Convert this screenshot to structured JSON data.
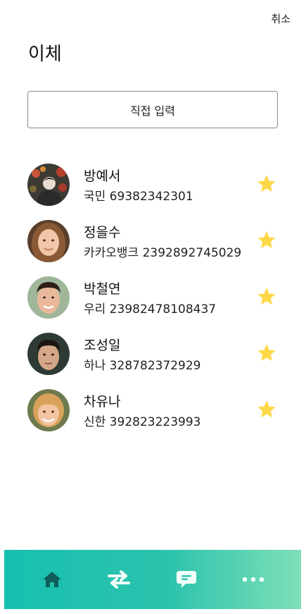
{
  "header": {
    "cancel_label": "취소",
    "title": "이체"
  },
  "direct_input_label": "직접 입력",
  "favorites": [
    {
      "name": "방예서",
      "account": "국민 69382342301",
      "starred": true
    },
    {
      "name": "정을수",
      "account": "카카오뱅크 2392892745029",
      "starred": true
    },
    {
      "name": "박철연",
      "account": "우리 23982478108437",
      "starred": true
    },
    {
      "name": "조성일",
      "account": "하나 328782372929",
      "starred": true
    },
    {
      "name": "차유나",
      "account": "신한 392823223993",
      "starred": true
    }
  ],
  "colors": {
    "star": "#FFD84A",
    "nav_gradient_start": "#17BFB0",
    "nav_gradient_end": "#7EDFB8",
    "nav_active_icon": "#0F5E5A",
    "nav_icon": "#F3FFFB"
  },
  "bottom_nav": [
    {
      "icon": "home-icon",
      "active": true
    },
    {
      "icon": "transfer-arrows-icon",
      "active": false
    },
    {
      "icon": "chat-bubble-icon",
      "active": false
    },
    {
      "icon": "more-dots-icon",
      "active": false
    }
  ]
}
